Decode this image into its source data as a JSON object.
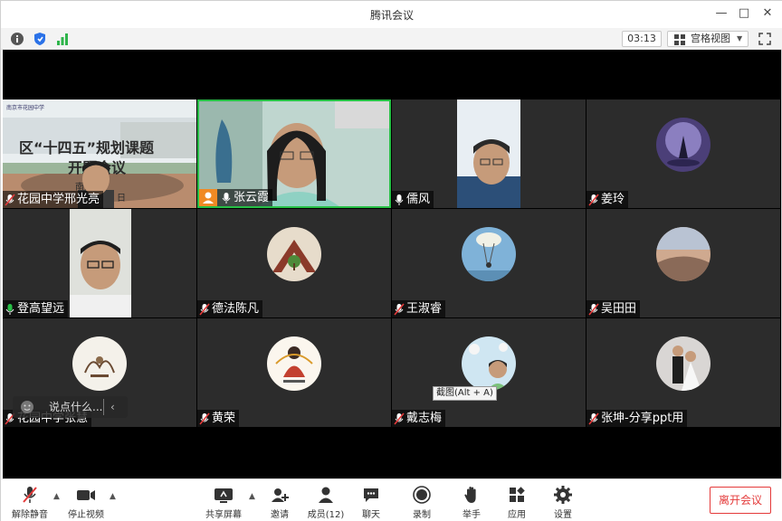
{
  "window": {
    "title": "腾讯会议",
    "controls": {
      "minimize": "—",
      "maximize": "□",
      "close": "✕"
    }
  },
  "infobar": {
    "timer": "03:13",
    "view_mode": "宫格视图",
    "icons": [
      "info-icon",
      "shield-icon",
      "signal-icon",
      "grid-icon",
      "fullscreen-icon"
    ]
  },
  "slide": {
    "title_line1": "区“十四五”规划课题",
    "title_line2": "开题会议",
    "school_fragment": "南京",
    "school_fragment2": "学",
    "date_fragment": "日",
    "logo_text": "南京市花园中学"
  },
  "participants": [
    {
      "name": "花园中学邢光亮",
      "mic": "muted",
      "type": "screen-share"
    },
    {
      "name": "张云霞",
      "mic": "on",
      "type": "video",
      "active": true
    },
    {
      "name": "儒风",
      "mic": "on",
      "type": "video"
    },
    {
      "name": "姜玲",
      "mic": "muted",
      "type": "avatar"
    },
    {
      "name": "登高望远",
      "mic": "speaking",
      "type": "video"
    },
    {
      "name": "德法陈凡",
      "mic": "muted",
      "type": "avatar"
    },
    {
      "name": "王淑睿",
      "mic": "muted",
      "type": "avatar"
    },
    {
      "name": "吴田田",
      "mic": "muted",
      "type": "avatar"
    },
    {
      "name": "花园中学张慧",
      "mic": "muted",
      "type": "avatar"
    },
    {
      "name": "黄荣",
      "mic": "muted",
      "type": "avatar"
    },
    {
      "name": "戴志梅",
      "mic": "muted",
      "type": "avatar"
    },
    {
      "name": "张坤-分享ppt用",
      "mic": "muted",
      "type": "avatar"
    }
  ],
  "chat": {
    "placeholder": "说点什么..."
  },
  "tooltip": {
    "text": "截图(Alt + A)"
  },
  "toolbar": {
    "unmute": "解除静音",
    "stop_video": "停止视频",
    "share_screen": "共享屏幕",
    "invite": "邀请",
    "members": "成员(12)",
    "chat": "聊天",
    "record": "录制",
    "raise_hand": "举手",
    "apps": "应用",
    "settings": "设置",
    "leave": "离开会议"
  },
  "colors": {
    "active_border": "#27c046",
    "leave": "#e43a3a",
    "tile_bg": "#2c2c2c",
    "speaking_mic": "#27c046",
    "muted_mic": "#e43a3a"
  }
}
